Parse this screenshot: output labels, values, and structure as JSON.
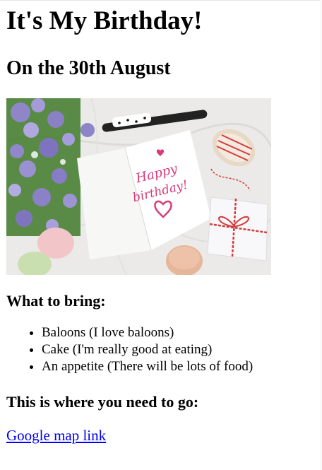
{
  "page": {
    "title": "It's My Birthday!",
    "subtitle": "On the 30th August",
    "image": {
      "icon": "birthday-card-photo",
      "card_text": "Happy birthday!"
    },
    "bring_heading": "What to bring:",
    "bring_items": [
      "Baloons (I love baloons)",
      "Cake (I'm really good at eating)",
      "An appetite (There will be lots of food)"
    ],
    "go_heading": "This is where you need to go:",
    "map_link": "Google map link"
  },
  "colors": {
    "link": "#0000ee",
    "card_ink": "#d83a7a",
    "background": "#ffffff"
  }
}
